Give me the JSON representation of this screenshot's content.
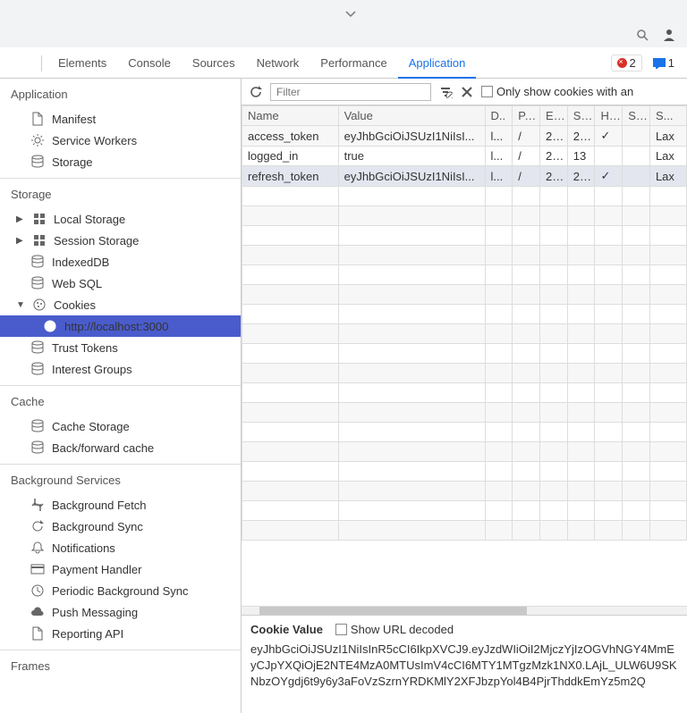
{
  "toolbar_top": {
    "zoom_icon": "zoom",
    "person_icon": "person",
    "chevron_icon": "chevron"
  },
  "tabs": {
    "items": [
      "Elements",
      "Console",
      "Sources",
      "Network",
      "Performance",
      "Application"
    ],
    "active": "Application",
    "errors": "2",
    "messages": "1"
  },
  "sidebar": {
    "application": {
      "title": "Application",
      "items": [
        {
          "icon": "file",
          "label": "Manifest"
        },
        {
          "icon": "gear",
          "label": "Service Workers"
        },
        {
          "icon": "db",
          "label": "Storage"
        }
      ]
    },
    "storage": {
      "title": "Storage",
      "items": [
        {
          "arrow": "▶",
          "icon": "grid",
          "label": "Local Storage"
        },
        {
          "arrow": "▶",
          "icon": "grid",
          "label": "Session Storage"
        },
        {
          "icon": "db",
          "label": "IndexedDB"
        },
        {
          "icon": "db",
          "label": "Web SQL"
        },
        {
          "arrow": "▼",
          "icon": "cookie",
          "label": "Cookies",
          "children": [
            {
              "icon": "cookie",
              "label": "http://localhost:3000",
              "selected": true
            }
          ]
        },
        {
          "icon": "db",
          "label": "Trust Tokens"
        },
        {
          "icon": "db",
          "label": "Interest Groups"
        }
      ]
    },
    "cache": {
      "title": "Cache",
      "items": [
        {
          "icon": "db",
          "label": "Cache Storage"
        },
        {
          "icon": "db",
          "label": "Back/forward cache"
        }
      ]
    },
    "background": {
      "title": "Background Services",
      "items": [
        {
          "icon": "fetch",
          "label": "Background Fetch"
        },
        {
          "icon": "sync",
          "label": "Background Sync"
        },
        {
          "icon": "bell",
          "label": "Notifications"
        },
        {
          "icon": "card",
          "label": "Payment Handler"
        },
        {
          "icon": "clock",
          "label": "Periodic Background Sync"
        },
        {
          "icon": "cloud",
          "label": "Push Messaging"
        },
        {
          "icon": "file",
          "label": "Reporting API"
        }
      ]
    },
    "frames": {
      "title": "Frames"
    }
  },
  "filter_bar": {
    "placeholder": "Filter",
    "only_label": "Only show cookies with an"
  },
  "table": {
    "headers": [
      "Name",
      "Value",
      "D..",
      "P...",
      "E...",
      "S...",
      "H...",
      "S...",
      "S..."
    ],
    "rows": [
      {
        "name": "access_token",
        "value": "eyJhbGciOiJSUzI1NiIsI...",
        "d": "l...",
        "p": "/",
        "e": "2...",
        "s": "2...",
        "h": "✓",
        "s2": "",
        "s3": "Lax"
      },
      {
        "name": "logged_in",
        "value": "true",
        "d": "l...",
        "p": "/",
        "e": "2...",
        "s": "13",
        "h": "",
        "s2": "",
        "s3": "Lax"
      },
      {
        "name": "refresh_token",
        "value": "eyJhbGciOiJSUzI1NiIsI...",
        "d": "l...",
        "p": "/",
        "e": "2...",
        "s": "2...",
        "h": "✓",
        "s2": "",
        "s3": "Lax",
        "selected": true
      }
    ]
  },
  "cookie_panel": {
    "title": "Cookie Value",
    "decoded_label": "Show URL decoded",
    "value": "eyJhbGciOiJSUzI1NiIsInR5cCI6IkpXVCJ9.eyJzdWIiOiI2MjczYjIzOGVhNGY4MmEyCJpYXQiOjE2NTE4MzA0MTUsImV4cCI6MTY1MTgzMzk1NX0.LAjL_ULW6U9SKNbzOYgdj6t9y6y3aFoVzSzrnYRDKMlY2XFJbzpYol4B4PjrThddkEmYz5m2Q"
  }
}
